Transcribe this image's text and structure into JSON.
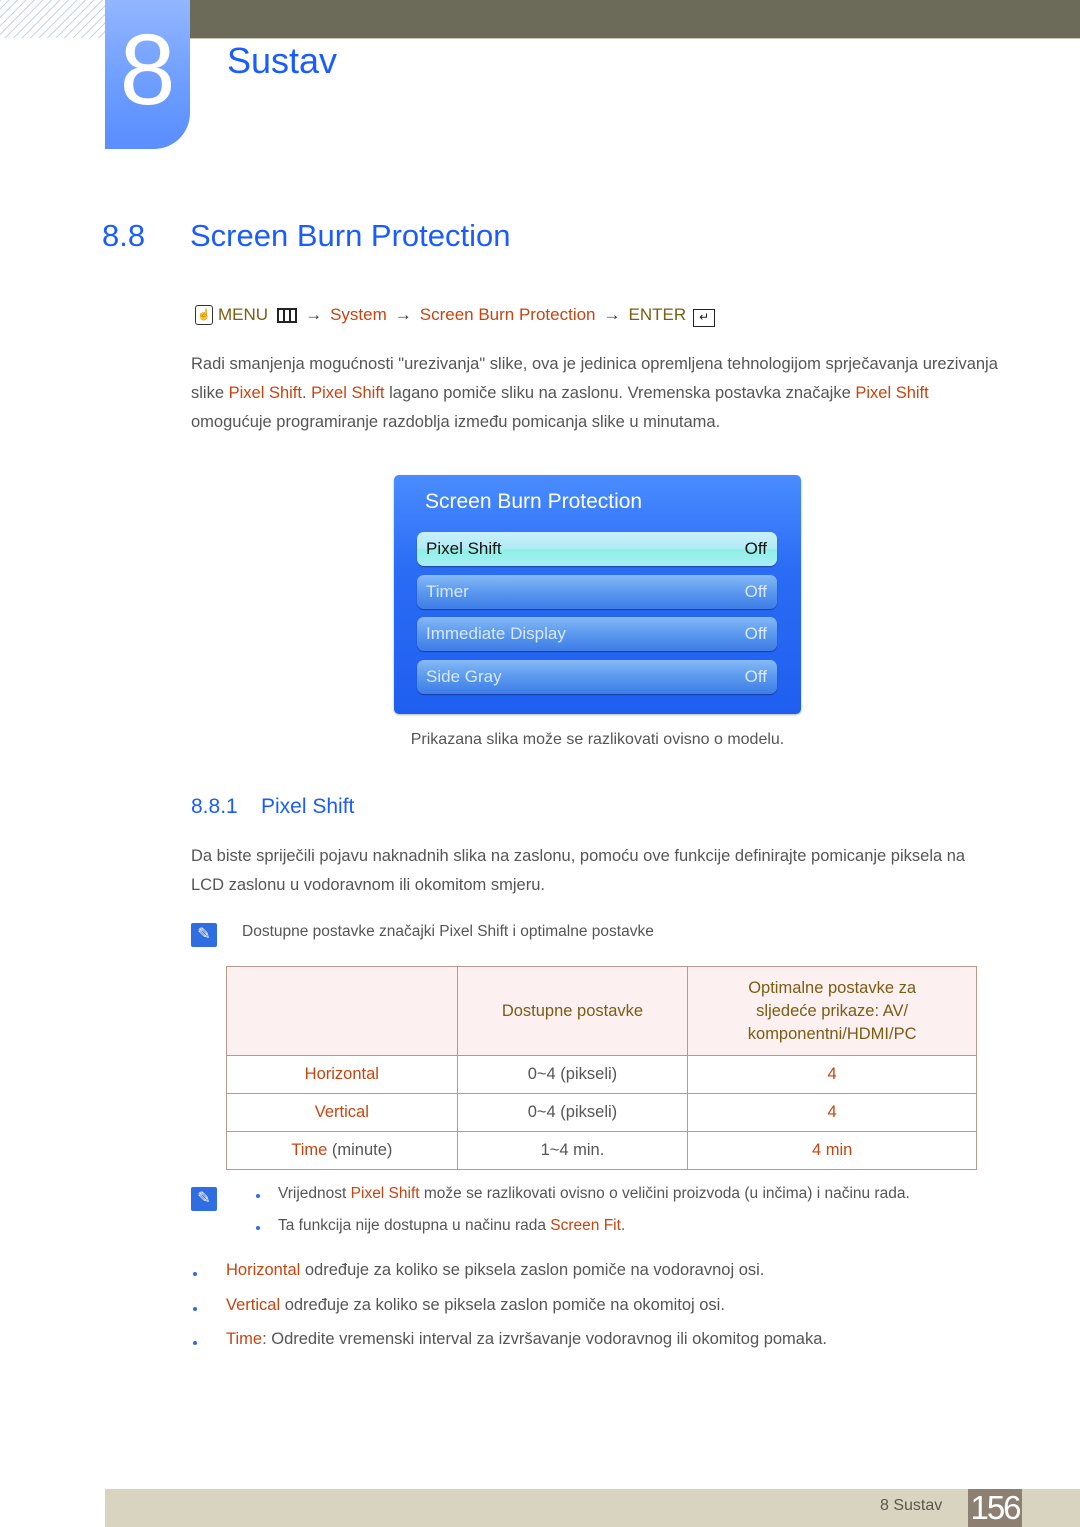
{
  "chapter": {
    "number": "8",
    "title": "Sustav"
  },
  "section": {
    "number": "8.8",
    "title": "Screen Burn Protection"
  },
  "menu_path": {
    "icon": "remote-hand-icon",
    "items": [
      {
        "text": "MENU",
        "icon": "menu-icon"
      },
      {
        "text": "System"
      },
      {
        "text": "Screen Burn Protection"
      },
      {
        "text": "ENTER",
        "icon": "enter-icon"
      }
    ],
    "arrow": "→"
  },
  "intro": {
    "t1": "Radi smanjenja mogućnosti \"urezivanja\" slike, ova je jedinica opremljena tehnologijom sprječavanja urezivanja slike ",
    "h1": "Pixel Shift",
    "t2": ". ",
    "h2": "Pixel Shift",
    "t3": " lagano pomiče sliku na zaslonu. Vremenska postavka značajke ",
    "h3": "Pixel Shift",
    "t4": " omogućuje programiranje razdoblja između pomicanja slike u minutama."
  },
  "osd": {
    "title": "Screen Burn Protection",
    "rows": [
      {
        "label": "Pixel Shift",
        "value": "Off",
        "selected": true
      },
      {
        "label": "Timer",
        "value": "Off"
      },
      {
        "label": "Immediate Display",
        "value": "Off"
      },
      {
        "label": "Side Gray",
        "value": "Off"
      }
    ],
    "caption": "Prikazana slika može se razlikovati ovisno o modelu."
  },
  "subsection": {
    "number": "8.8.1",
    "title": "Pixel Shift",
    "para": "Da biste spriječili pojavu naknadnih slika na zaslonu, pomoću ove funkcije definirajte pomicanje piksela na LCD zaslonu u vodoravnom ili okomitom smjeru.",
    "note": "Dostupne postavke značajki Pixel Shift i optimalne postavke"
  },
  "table": {
    "headers": [
      "",
      "Dostupne postavke",
      "Optimalne postavke za sljedeće prikaze: AV/ komponentni/HDMI/PC"
    ],
    "header_lines": [
      "Optimalne postavke za",
      "sljedeće prikaze: AV/",
      "komponentni/HDMI/PC"
    ],
    "rows": [
      {
        "name": "Horizontal",
        "suffix": "",
        "range": "0~4 (pikseli)",
        "optimal": "4"
      },
      {
        "name": "Vertical",
        "suffix": "",
        "range": "0~4 (pikseli)",
        "optimal": "4"
      },
      {
        "name": "Time",
        "suffix": " (minute)",
        "range": "1~4 min.",
        "optimal": "4 min"
      }
    ]
  },
  "notes": [
    {
      "pre": "Vrijednost ",
      "hl": "Pixel Shift",
      "post": " može se razlikovati ovisno o veličini proizvoda (u inčima) i načinu rada."
    },
    {
      "pre": "Ta funkcija nije dostupna u načinu rada ",
      "hl": "Screen Fit",
      "post": "."
    }
  ],
  "bullets": [
    {
      "hl": "Horizontal",
      "post": " određuje za koliko se piksela zaslon pomiče na vodoravnoj osi."
    },
    {
      "hl": "Vertical",
      "post": " određuje za koliko se piksela zaslon pomiče na okomitoj osi."
    },
    {
      "hl": "Time",
      "post": ": Odredite vremenski interval za izvršavanje vodoravnog ili okomitog pomaka."
    }
  ],
  "footer": {
    "label": "8 Sustav",
    "page": "156"
  }
}
